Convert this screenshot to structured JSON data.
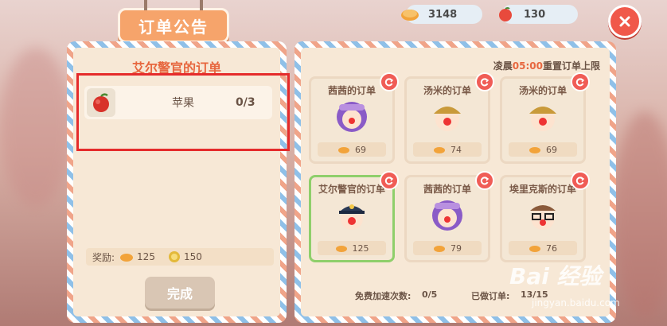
{
  "header": {
    "title": "订单公告",
    "currency_gold": "3148",
    "currency_apple": "130",
    "close_icon": "close-icon"
  },
  "order": {
    "officer_title": "艾尔警官的订单",
    "item": {
      "icon": "apple-icon",
      "name": "苹果",
      "count": "0/3"
    },
    "reward_label": "奖励:",
    "reward_gold": "125",
    "reward_exp": "150",
    "done_label": "完成"
  },
  "board": {
    "reset_prefix": "凌晨",
    "reset_time": "05:00",
    "reset_suffix": "重置订单上限",
    "cards": [
      {
        "title": "茜茜的订单",
        "reward": "69",
        "face": "cici"
      },
      {
        "title": "汤米的订单",
        "reward": "74",
        "face": "tommy"
      },
      {
        "title": "汤米的订单",
        "reward": "69",
        "face": "tommy"
      },
      {
        "title": "艾尔警官的订单",
        "reward": "125",
        "face": "officer"
      },
      {
        "title": "茜茜的订单",
        "reward": "79",
        "face": "cici"
      },
      {
        "title": "埃里克斯的订单",
        "reward": "76",
        "face": "eric"
      }
    ],
    "free_speedup_label": "免费加速次数:",
    "free_speedup_value": "0/5",
    "done_orders_label": "已做订单:",
    "done_orders_value": "13/15"
  },
  "watermark": {
    "main": "Bai 经验",
    "sub": "jingyan.baidu.com"
  },
  "colors": {
    "accent": "#f6a46b",
    "title_red": "#e7673f",
    "highlight": "#e52b2b"
  }
}
